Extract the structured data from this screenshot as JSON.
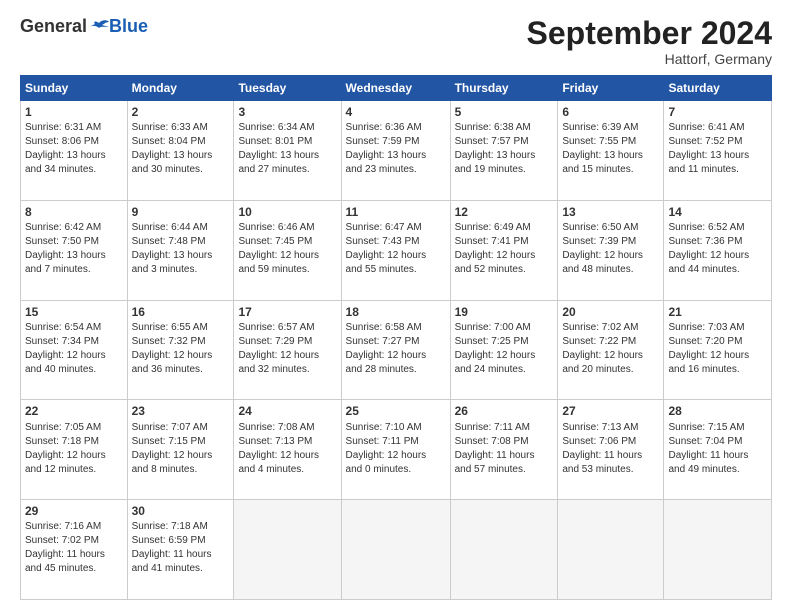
{
  "header": {
    "logo_general": "General",
    "logo_blue": "Blue",
    "month_title": "September 2024",
    "location": "Hattorf, Germany"
  },
  "columns": [
    "Sunday",
    "Monday",
    "Tuesday",
    "Wednesday",
    "Thursday",
    "Friday",
    "Saturday"
  ],
  "weeks": [
    [
      {
        "day": "1",
        "info": "Sunrise: 6:31 AM\nSunset: 8:06 PM\nDaylight: 13 hours\nand 34 minutes."
      },
      {
        "day": "2",
        "info": "Sunrise: 6:33 AM\nSunset: 8:04 PM\nDaylight: 13 hours\nand 30 minutes."
      },
      {
        "day": "3",
        "info": "Sunrise: 6:34 AM\nSunset: 8:01 PM\nDaylight: 13 hours\nand 27 minutes."
      },
      {
        "day": "4",
        "info": "Sunrise: 6:36 AM\nSunset: 7:59 PM\nDaylight: 13 hours\nand 23 minutes."
      },
      {
        "day": "5",
        "info": "Sunrise: 6:38 AM\nSunset: 7:57 PM\nDaylight: 13 hours\nand 19 minutes."
      },
      {
        "day": "6",
        "info": "Sunrise: 6:39 AM\nSunset: 7:55 PM\nDaylight: 13 hours\nand 15 minutes."
      },
      {
        "day": "7",
        "info": "Sunrise: 6:41 AM\nSunset: 7:52 PM\nDaylight: 13 hours\nand 11 minutes."
      }
    ],
    [
      {
        "day": "8",
        "info": "Sunrise: 6:42 AM\nSunset: 7:50 PM\nDaylight: 13 hours\nand 7 minutes."
      },
      {
        "day": "9",
        "info": "Sunrise: 6:44 AM\nSunset: 7:48 PM\nDaylight: 13 hours\nand 3 minutes."
      },
      {
        "day": "10",
        "info": "Sunrise: 6:46 AM\nSunset: 7:45 PM\nDaylight: 12 hours\nand 59 minutes."
      },
      {
        "day": "11",
        "info": "Sunrise: 6:47 AM\nSunset: 7:43 PM\nDaylight: 12 hours\nand 55 minutes."
      },
      {
        "day": "12",
        "info": "Sunrise: 6:49 AM\nSunset: 7:41 PM\nDaylight: 12 hours\nand 52 minutes."
      },
      {
        "day": "13",
        "info": "Sunrise: 6:50 AM\nSunset: 7:39 PM\nDaylight: 12 hours\nand 48 minutes."
      },
      {
        "day": "14",
        "info": "Sunrise: 6:52 AM\nSunset: 7:36 PM\nDaylight: 12 hours\nand 44 minutes."
      }
    ],
    [
      {
        "day": "15",
        "info": "Sunrise: 6:54 AM\nSunset: 7:34 PM\nDaylight: 12 hours\nand 40 minutes."
      },
      {
        "day": "16",
        "info": "Sunrise: 6:55 AM\nSunset: 7:32 PM\nDaylight: 12 hours\nand 36 minutes."
      },
      {
        "day": "17",
        "info": "Sunrise: 6:57 AM\nSunset: 7:29 PM\nDaylight: 12 hours\nand 32 minutes."
      },
      {
        "day": "18",
        "info": "Sunrise: 6:58 AM\nSunset: 7:27 PM\nDaylight: 12 hours\nand 28 minutes."
      },
      {
        "day": "19",
        "info": "Sunrise: 7:00 AM\nSunset: 7:25 PM\nDaylight: 12 hours\nand 24 minutes."
      },
      {
        "day": "20",
        "info": "Sunrise: 7:02 AM\nSunset: 7:22 PM\nDaylight: 12 hours\nand 20 minutes."
      },
      {
        "day": "21",
        "info": "Sunrise: 7:03 AM\nSunset: 7:20 PM\nDaylight: 12 hours\nand 16 minutes."
      }
    ],
    [
      {
        "day": "22",
        "info": "Sunrise: 7:05 AM\nSunset: 7:18 PM\nDaylight: 12 hours\nand 12 minutes."
      },
      {
        "day": "23",
        "info": "Sunrise: 7:07 AM\nSunset: 7:15 PM\nDaylight: 12 hours\nand 8 minutes."
      },
      {
        "day": "24",
        "info": "Sunrise: 7:08 AM\nSunset: 7:13 PM\nDaylight: 12 hours\nand 4 minutes."
      },
      {
        "day": "25",
        "info": "Sunrise: 7:10 AM\nSunset: 7:11 PM\nDaylight: 12 hours\nand 0 minutes."
      },
      {
        "day": "26",
        "info": "Sunrise: 7:11 AM\nSunset: 7:08 PM\nDaylight: 11 hours\nand 57 minutes."
      },
      {
        "day": "27",
        "info": "Sunrise: 7:13 AM\nSunset: 7:06 PM\nDaylight: 11 hours\nand 53 minutes."
      },
      {
        "day": "28",
        "info": "Sunrise: 7:15 AM\nSunset: 7:04 PM\nDaylight: 11 hours\nand 49 minutes."
      }
    ],
    [
      {
        "day": "29",
        "info": "Sunrise: 7:16 AM\nSunset: 7:02 PM\nDaylight: 11 hours\nand 45 minutes."
      },
      {
        "day": "30",
        "info": "Sunrise: 7:18 AM\nSunset: 6:59 PM\nDaylight: 11 hours\nand 41 minutes."
      },
      {
        "day": "",
        "info": ""
      },
      {
        "day": "",
        "info": ""
      },
      {
        "day": "",
        "info": ""
      },
      {
        "day": "",
        "info": ""
      },
      {
        "day": "",
        "info": ""
      }
    ]
  ]
}
